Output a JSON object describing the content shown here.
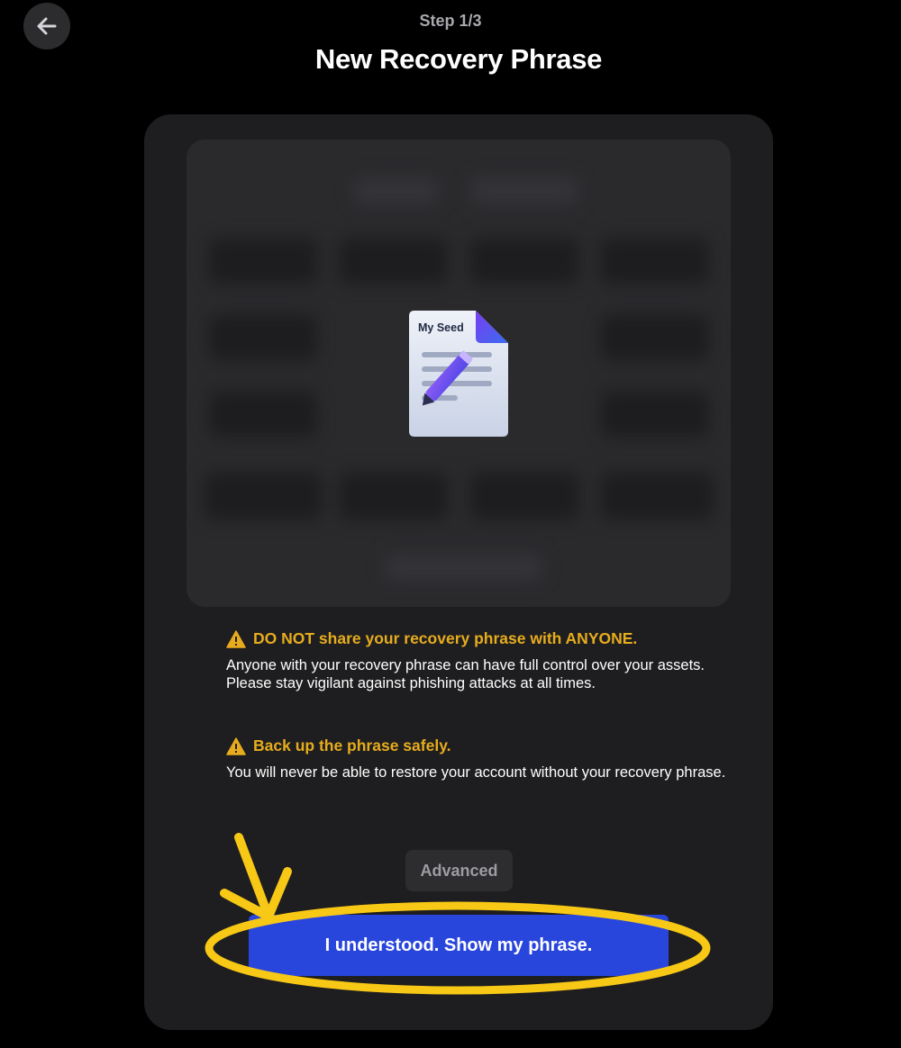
{
  "header": {
    "step": "Step 1/3",
    "title": "New Recovery Phrase"
  },
  "seed_panel": {
    "icon_label": "My Seed"
  },
  "warnings": [
    {
      "title": "DO NOT share your recovery phrase with ANYONE.",
      "body": "Anyone with your recovery phrase can have full control over your assets. Please stay vigilant against phishing attacks at all times."
    },
    {
      "title": "Back up the phrase safely.",
      "body": "You will never be able to restore your account without your recovery phrase."
    }
  ],
  "actions": {
    "advanced_label": "Advanced",
    "show_label": "I understood. Show my phrase."
  },
  "colors": {
    "background": "#000000",
    "card": "#1e1e20",
    "warning": "#e7ac1d",
    "primary_button": "#2946dc",
    "annotation": "#f7c815"
  },
  "icons": [
    "back-arrow-icon",
    "seed-document-icon",
    "warning-icon"
  ]
}
